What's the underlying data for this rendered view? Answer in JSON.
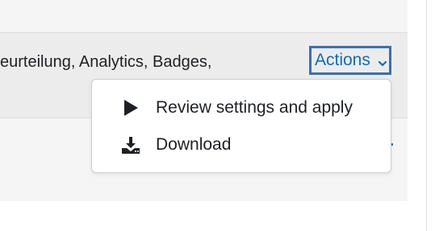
{
  "row": {
    "text": "eurteilung, Analytics, Badges,"
  },
  "actions_button": {
    "label": "Actions",
    "chevron_icon": "chevron-down-icon",
    "accent_color": "#0f6cbf",
    "focus_color": "#3a6fb0"
  },
  "menu": {
    "items": [
      {
        "label": "Review settings and apply",
        "icon": "play-icon"
      },
      {
        "label": "Download",
        "icon": "download-icon"
      }
    ]
  }
}
